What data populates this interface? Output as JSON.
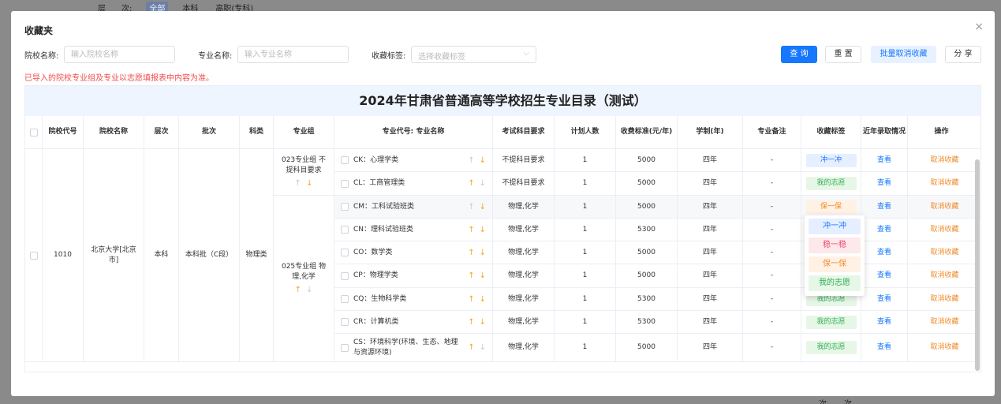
{
  "background": {
    "filter_label": "层　　次:",
    "filter_options": [
      "全部",
      "本科",
      "高职(专科)"
    ],
    "bottom_text": [
      "次",
      "次"
    ]
  },
  "dialog": {
    "title": "收藏夹",
    "close_glyph": "×"
  },
  "filters": {
    "school_label": "院校名称:",
    "school_placeholder": "输入院校名称",
    "major_label": "专业名称:",
    "major_placeholder": "输入专业名称",
    "tag_label": "收藏标签:",
    "tag_placeholder": "选择收藏标签"
  },
  "buttons": {
    "query": "查 询",
    "reset": "重 置",
    "batch_cancel": "批量取消收藏",
    "share": "分 享"
  },
  "notice": "已导入的院校专业组及专业以志愿填报表中内容为准。",
  "table": {
    "caption": "2024年甘肃省普通高等学校招生专业目录（测试）",
    "headers": [
      "",
      "院校代号",
      "院校名称",
      "层次",
      "批次",
      "科类",
      "专业组",
      "专业代号: 专业名称",
      "考试科目要求",
      "计划人数",
      "收费标准(元/年)",
      "学制(年)",
      "专业备注",
      "收藏标签",
      "近年录取情况",
      "操作"
    ],
    "school": {
      "code": "1010",
      "name": "北京大学[北京市]",
      "level": "本科",
      "batch": "本科批（C段）",
      "category": "物理类"
    },
    "groups": [
      {
        "label": "023专业组 不提科目要求"
      },
      {
        "label": "025专业组 物理,化学"
      }
    ],
    "rows": [
      {
        "major": "CK：心理学类",
        "subject": "不提科目要求",
        "plan": "1",
        "fee": "5000",
        "years": "四年",
        "remark": "-",
        "tag": "冲一冲",
        "view": "查看",
        "op": "取消收藏"
      },
      {
        "major": "CL：工商管理类",
        "subject": "不提科目要求",
        "plan": "1",
        "fee": "5000",
        "years": "四年",
        "remark": "-",
        "tag": "我的志愿",
        "view": "查看",
        "op": "取消收藏"
      },
      {
        "major": "CM：工科试验班类",
        "subject": "物理,化学",
        "plan": "1",
        "fee": "5000",
        "years": "四年",
        "remark": "-",
        "tag": "保一保",
        "view": "查看",
        "op": "取消收藏"
      },
      {
        "major": "CN：理科试验班类",
        "subject": "物理,化学",
        "plan": "1",
        "fee": "5300",
        "years": "四年",
        "remark": "-",
        "tag": "",
        "view": "查看",
        "op": "取消收藏"
      },
      {
        "major": "CO：数学类",
        "subject": "物理,化学",
        "plan": "1",
        "fee": "5000",
        "years": "四年",
        "remark": "-",
        "tag": "",
        "view": "查看",
        "op": "取消收藏"
      },
      {
        "major": "CP：物理学类",
        "subject": "物理,化学",
        "plan": "1",
        "fee": "5000",
        "years": "四年",
        "remark": "-",
        "tag": "",
        "view": "查看",
        "op": "取消收藏"
      },
      {
        "major": "CQ：生物科学类",
        "subject": "物理,化学",
        "plan": "1",
        "fee": "5300",
        "years": "四年",
        "remark": "-",
        "tag": "我的志愿",
        "view": "查看",
        "op": "取消收藏"
      },
      {
        "major": "CR：计算机类",
        "subject": "物理,化学",
        "plan": "1",
        "fee": "5300",
        "years": "四年",
        "remark": "-",
        "tag": "我的志愿",
        "view": "查看",
        "op": "取消收藏"
      },
      {
        "major": "CS：环境科学(环境、生态、地理与资源环境)",
        "subject": "物理,化学",
        "plan": "1",
        "fee": "5000",
        "years": "四年",
        "remark": "-",
        "tag": "我的志愿",
        "view": "查看",
        "op": "取消收藏"
      }
    ]
  },
  "popup_options": [
    "冲一冲",
    "稳一稳",
    "保一保",
    "我的志愿"
  ],
  "colors": {
    "primary": "#1677ff",
    "warning_text": "#f04b4b",
    "cancel_link": "#f08c2b"
  }
}
